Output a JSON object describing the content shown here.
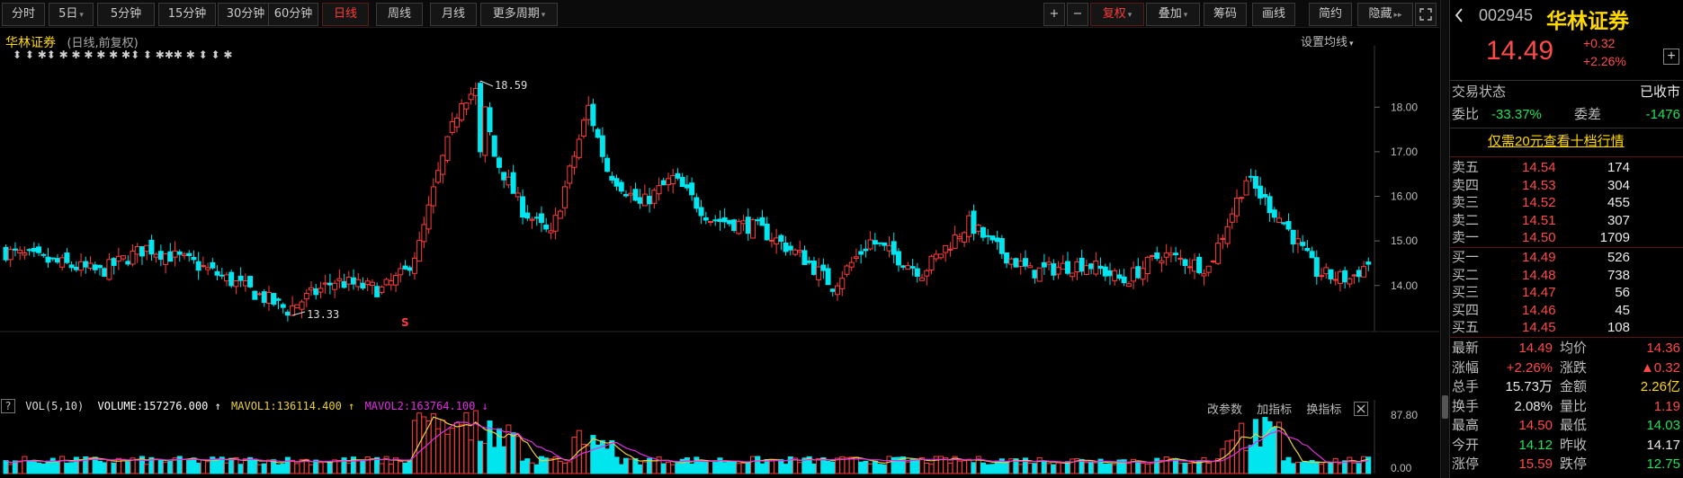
{
  "toolbar": {
    "periods": [
      "分时",
      "5日",
      "5分钟",
      "15分钟",
      "30分钟",
      "60分钟",
      "日线",
      "周线",
      "月线",
      "更多周期"
    ],
    "active_period": "日线",
    "actions": [
      "+",
      "−",
      "复权",
      "叠加",
      "筹码",
      "画线",
      "简约",
      "隐藏"
    ],
    "fuquan_label": "复权",
    "more_periods_dropdown": "▾",
    "hide_arrows": "▸▸",
    "fullscreen_icon": "expand-icon"
  },
  "chart": {
    "stock_name": "华林证券",
    "mode_label": "(日线,前复权)",
    "settings_label": "设置均线",
    "high_marker": "18.59",
    "low_marker": "13.33",
    "s_marker": "S",
    "info_markers": "⬍ ⬍ ✱⬍ ✱ ✱ ✱ ✱ ✱ ✱⬍ ⬍ ✱✱✱ ✱ ⬍ ⬍ ✱"
  },
  "volume": {
    "help_icon": "?",
    "indicator_name": "VOL(5,10)",
    "volume_label": "VOLUME:157276.000",
    "mavol1_label": "MAVOL1:136114.400",
    "mavol2_label": "MAVOL2:163764.100",
    "buttons": [
      "改参数",
      "加指标",
      "换指标"
    ],
    "close_icon": "close-icon"
  },
  "chart_data": {
    "type": "candlestick",
    "title": "华林证券 (日线,前复权)",
    "y_ticks": [
      14.0,
      15.0,
      16.0,
      17.0,
      18.0
    ],
    "ylim": [
      13.2,
      18.7
    ],
    "annotated_high": 18.59,
    "annotated_low": 13.33,
    "volume_ticks": [
      "87.80",
      "0.00"
    ],
    "volume_indicator": {
      "name": "VOL(5,10)",
      "VOLUME": 157276.0,
      "MAVOL1": 136114.4,
      "MAVOL2": 163764.1
    },
    "colors": {
      "up": "#ff3c3c",
      "down": "#00e5ee",
      "mavol1": "#e8d040",
      "mavol2": "#e030e0"
    }
  },
  "panel": {
    "code": "002945",
    "name": "华林证券",
    "price": "14.49",
    "change": "+0.32",
    "change_pct": "+2.26%",
    "add_icon": "+",
    "trade_status_label": "交易状态",
    "trade_status": "已收市",
    "weibi_label": "委比",
    "weibi": "-33.37%",
    "weicha_label": "委差",
    "weicha": "-1476",
    "promo": "仅需20元查看十档行情",
    "asks": [
      {
        "label": "卖五",
        "price": "14.54",
        "vol": "174"
      },
      {
        "label": "卖四",
        "price": "14.53",
        "vol": "304"
      },
      {
        "label": "卖三",
        "price": "14.52",
        "vol": "455"
      },
      {
        "label": "卖二",
        "price": "14.51",
        "vol": "307"
      },
      {
        "label": "卖一",
        "price": "14.50",
        "vol": "1709"
      }
    ],
    "bids": [
      {
        "label": "买一",
        "price": "14.49",
        "vol": "526"
      },
      {
        "label": "买二",
        "price": "14.48",
        "vol": "738"
      },
      {
        "label": "买三",
        "price": "14.47",
        "vol": "56"
      },
      {
        "label": "买四",
        "price": "14.46",
        "vol": "45"
      },
      {
        "label": "买五",
        "price": "14.45",
        "vol": "108"
      }
    ],
    "stats": [
      {
        "l1": "最新",
        "v1": "14.49",
        "c1": "red",
        "l2": "均价",
        "v2": "14.36",
        "c2": "red"
      },
      {
        "l1": "涨幅",
        "v1": "+2.26%",
        "c1": "red",
        "l2": "涨跌",
        "v2": "▲0.32",
        "c2": "red"
      },
      {
        "l1": "总手",
        "v1": "15.73万",
        "c1": "white",
        "l2": "金额",
        "v2": "2.26亿",
        "c2": "yellow"
      },
      {
        "l1": "换手",
        "v1": "2.08%",
        "c1": "white",
        "l2": "量比",
        "v2": "1.19",
        "c2": "red"
      },
      {
        "l1": "最高",
        "v1": "14.50",
        "c1": "red",
        "l2": "最低",
        "v2": "14.03",
        "c2": "green"
      },
      {
        "l1": "今开",
        "v1": "14.12",
        "c1": "green",
        "l2": "昨收",
        "v2": "14.17",
        "c2": "white"
      },
      {
        "l1": "涨停",
        "v1": "15.59",
        "c1": "red",
        "l2": "跌停",
        "v2": "12.75",
        "c2": "green"
      }
    ]
  }
}
